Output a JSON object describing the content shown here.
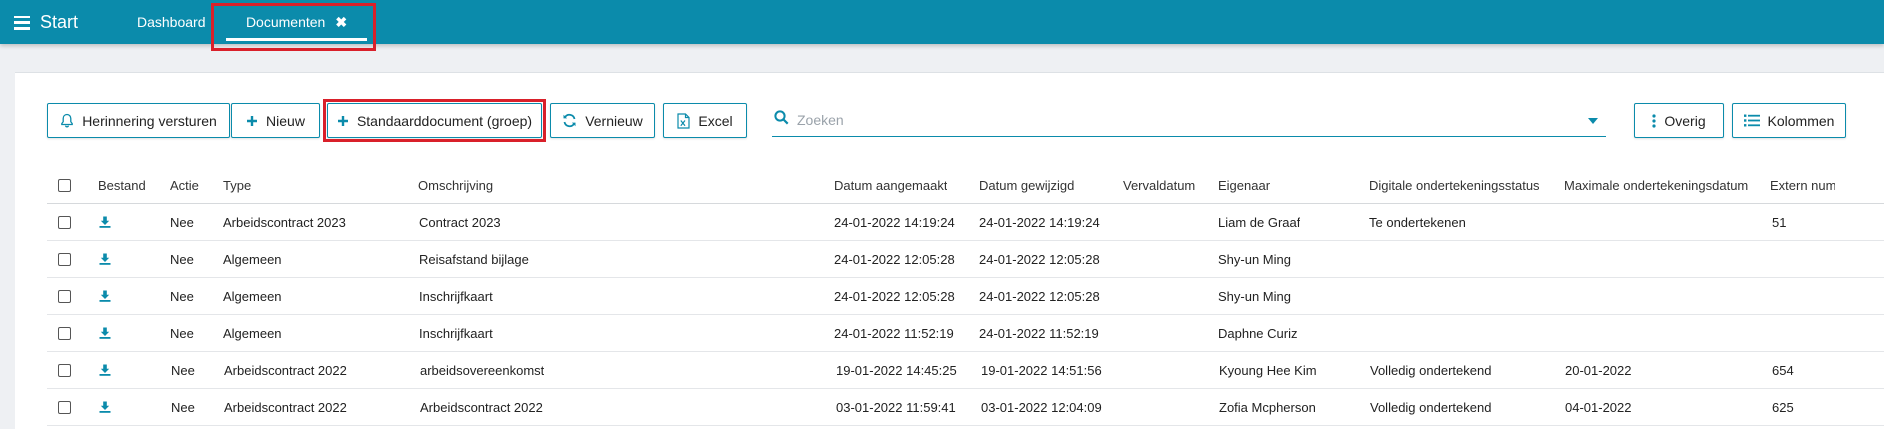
{
  "topbar": {
    "start_label": "Start",
    "tabs": [
      {
        "label": "Dashboard"
      },
      {
        "label": "Documenten",
        "close": "✖"
      }
    ]
  },
  "toolbar": {
    "reminder_label": "Herinnering versturen",
    "new_label": "Nieuw",
    "standard_doc_label": "Standaarddocument (groep)",
    "refresh_label": "Vernieuw",
    "excel_label": "Excel",
    "search_placeholder": "Zoeken",
    "more_label": "Overig",
    "columns_label": "Kolommen"
  },
  "table": {
    "columns": [
      "Bestand",
      "Actie",
      "Type",
      "Omschrijving",
      "Datum aangemaakt",
      "Datum gewijzigd",
      "Vervaldatum",
      "Eigenaar",
      "Digitale ondertekeningsstatus",
      "Maximale ondertekeningsdatum",
      "Extern numm"
    ],
    "rows": [
      {
        "actie": "Nee",
        "type": "Arbeidscontract 2023",
        "omschrijving": "Contract 2023",
        "aangemaakt": "24-01-2022 14:19:24",
        "gewijzigd": "24-01-2022 14:19:24",
        "verval": "",
        "eigenaar": "Liam de Graaf",
        "status": "Te ondertekenen",
        "max": "",
        "extern": "51"
      },
      {
        "actie": "Nee",
        "type": "Algemeen",
        "omschrijving": "Reisafstand bijlage",
        "aangemaakt": "24-01-2022 12:05:28",
        "gewijzigd": "24-01-2022 12:05:28",
        "verval": "",
        "eigenaar": "Shy-un Ming",
        "status": "",
        "max": "",
        "extern": ""
      },
      {
        "actie": "Nee",
        "type": "Algemeen",
        "omschrijving": "Inschrijfkaart",
        "aangemaakt": "24-01-2022 12:05:28",
        "gewijzigd": "24-01-2022 12:05:28",
        "verval": "",
        "eigenaar": "Shy-un Ming",
        "status": "",
        "max": "",
        "extern": ""
      },
      {
        "actie": "Nee",
        "type": "Algemeen",
        "omschrijving": "Inschrijfkaart",
        "aangemaakt": "24-01-2022 11:52:19",
        "gewijzigd": "24-01-2022 11:52:19",
        "verval": "",
        "eigenaar": "Daphne Curiz",
        "status": "",
        "max": "",
        "extern": ""
      },
      {
        "actie": "Nee",
        "type": "Arbeidscontract 2022",
        "omschrijving": "arbeidsovereenkomst",
        "aangemaakt": "19-01-2022 14:45:25",
        "gewijzigd": "19-01-2022 14:51:56",
        "verval": "",
        "eigenaar": "Kyoung Hee Kim",
        "status": "Volledig ondertekend",
        "max": "20-01-2022",
        "extern": "654"
      },
      {
        "actie": "Nee",
        "type": "Arbeidscontract 2022",
        "omschrijving": "Arbeidscontract 2022",
        "aangemaakt": "03-01-2022 11:59:41",
        "gewijzigd": "03-01-2022 12:04:09",
        "verval": "",
        "eigenaar": "Zofia Mcpherson",
        "status": "Volledig ondertekend",
        "max": "04-01-2022",
        "extern": "625"
      }
    ]
  },
  "colors": {
    "accent": "#0b8bab",
    "highlight": "#d9202a"
  },
  "icons": {
    "menu": "hamburger-icon",
    "reminder": "bell-icon",
    "new": "plus-icon",
    "refresh": "refresh-icon",
    "excel": "excel-file-icon",
    "search": "search-icon",
    "more": "vertical-dots-icon",
    "columns": "list-icon",
    "download": "download-icon"
  }
}
